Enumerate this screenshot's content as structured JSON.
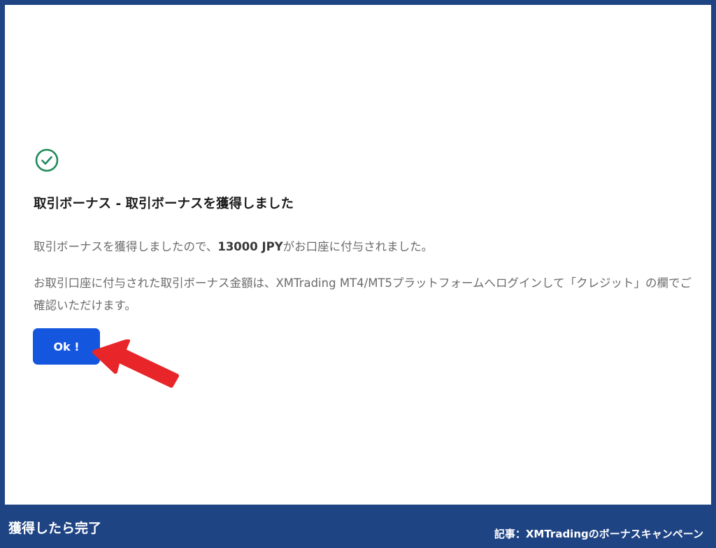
{
  "dialog": {
    "title": "取引ボーナス - 取引ボーナスを獲得しました",
    "message_prefix": "取引ボーナスを獲得しましたので、",
    "bonus_amount": "13000 JPY",
    "message_suffix": "がお口座に付与されました。",
    "detail": "お取引口座に付与された取引ボーナス金額は、XMTrading MT4/MT5プラットフォームへログインして「クレジット」の欄でご確認いただけます。",
    "ok_label": "Ok !"
  },
  "caption": {
    "left": "獲得したら完了",
    "right": "記事：XMTradingのボーナスキャンペーン"
  },
  "colors": {
    "frame": "#1f4484",
    "success": "#1f8a5b",
    "button": "#1556df",
    "arrow": "#e8262a"
  }
}
